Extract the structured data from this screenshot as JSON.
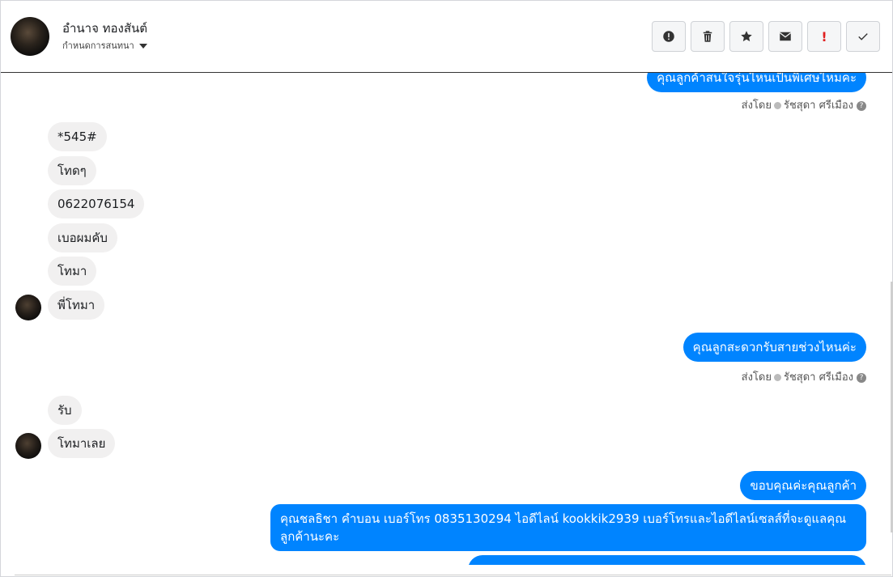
{
  "header": {
    "name": "อำนาจ ทองสันต์",
    "subtitle": "กำหนดการสนทนา",
    "toolbar": [
      "alert-circle-icon",
      "trash-icon",
      "star-icon",
      "envelope-icon",
      "exclamation-icon",
      "check-icon"
    ]
  },
  "thread": {
    "out1": "คุณลูกค้าสนใจรุ่นไหนเป็นพิเศษไหมคะ",
    "meta_prefix": "ส่งโดย",
    "meta_agent": "รัชสุดา ศรีเมือง",
    "in_group1": [
      "*545#",
      "โทดๆ",
      "0622076154",
      "เบอผมคับ",
      "โทมา",
      "พี่โทมา"
    ],
    "out2": "คุณลูกสะดวกรับสายช่วงไหนค่ะ",
    "in_group2": [
      "รับ",
      "โทมาเลย"
    ],
    "out3": "ขอบคุณค่ะคุณลูกค้า",
    "out4": "คุณชลธิชา คำบอน เบอร์โทร 0835130294  ไอดีไลน์ kookkik2939   เบอร์โทรและไอดีไลน์เซลส์ที่จะดูแลคุณลูกค้านะคะ"
  },
  "colors": {
    "outgoing": "#0084ff",
    "incoming": "#f1f0f0"
  }
}
